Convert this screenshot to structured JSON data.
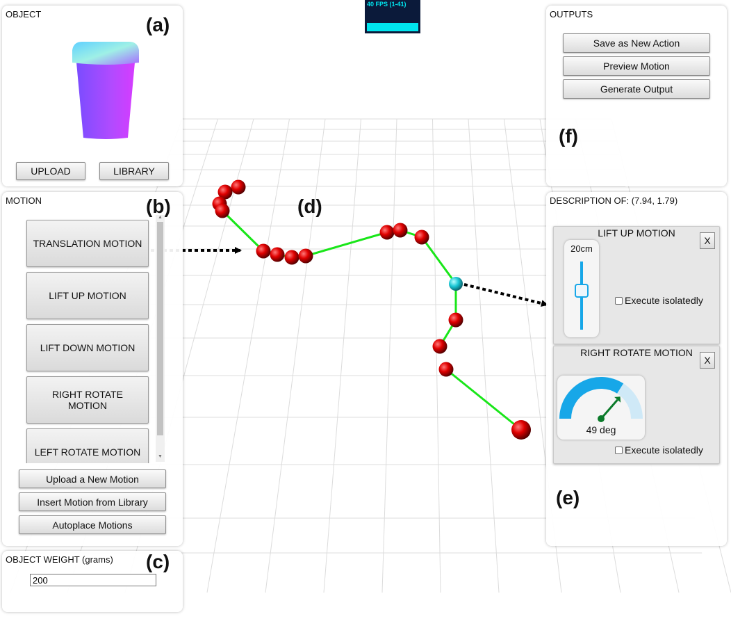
{
  "fps": {
    "text": "40 FPS (1-41)"
  },
  "object_panel": {
    "title": "OBJECT",
    "tag": "(a)",
    "upload_label": "UPLOAD",
    "library_label": "LIBRARY"
  },
  "motion_panel": {
    "title": "MOTION",
    "tag": "(b)",
    "items": [
      {
        "label": "TRANSLATION MOTION"
      },
      {
        "label": "LIFT UP MOTION"
      },
      {
        "label": "LIFT DOWN MOTION"
      },
      {
        "label": "RIGHT ROTATE MOTION"
      },
      {
        "label": "LEFT ROTATE MOTION"
      }
    ],
    "upload_new_label": "Upload a New Motion",
    "insert_library_label": "Insert Motion from Library",
    "autoplace_label": "Autoplace Motions"
  },
  "weight_panel": {
    "title": "OBJECT WEIGHT (grams)",
    "tag": "(c)",
    "value": "200"
  },
  "scene": {
    "tag": "(d)"
  },
  "outputs_panel": {
    "title": "OUTPUTS",
    "tag": "(f)",
    "save_label": "Save as New Action",
    "preview_label": "Preview Motion",
    "generate_label": "Generate Output"
  },
  "description_panel": {
    "title": "DESCRIPTION OF: (7.94, 1.79)",
    "tag": "(e)",
    "lift_card": {
      "title": "LIFT UP MOTION",
      "close_label": "X",
      "value_label": "20cm",
      "slider_fraction": 0.57,
      "checkbox_label": "Execute isolatedly"
    },
    "rotate_card": {
      "title": "RIGHT ROTATE MOTION",
      "close_label": "X",
      "angle_label": "49 deg",
      "angle_deg": 49,
      "checkbox_label": "Execute isolatedly"
    }
  },
  "colors": {
    "path": "#19e619",
    "keypoint": "#e00000",
    "selected_keypoint": "#19c6d4",
    "gauge": "#17a7e8",
    "gauge_light": "#cfe9f7",
    "fps_bg": "#0b1a3a",
    "fps_bar": "#00e5ee"
  }
}
